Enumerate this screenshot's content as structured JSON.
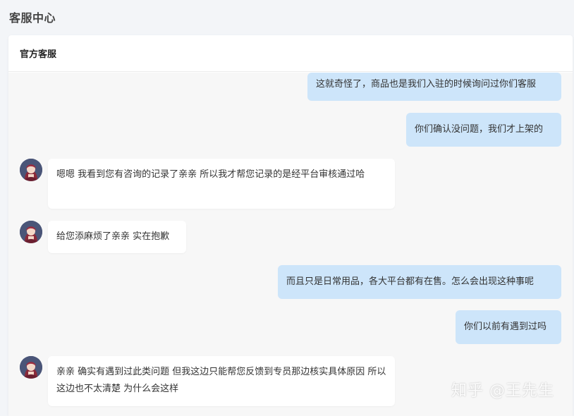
{
  "page": {
    "title": "客服中心"
  },
  "panel": {
    "title": "官方客服"
  },
  "messages": [
    {
      "side": "right",
      "text": "这就奇怪了，商品也是我们入驻的时候询问过你们客服"
    },
    {
      "side": "right",
      "text": "你们确认没问题，我们才上架的"
    },
    {
      "side": "left",
      "avatar": "agent-avatar",
      "text": "嗯嗯 我看到您有咨询的记录了亲亲 所以我才帮您记录的是经平台审核通过哈"
    },
    {
      "side": "left",
      "avatar": "agent-avatar",
      "text": "给您添麻烦了亲亲 实在抱歉"
    },
    {
      "side": "right",
      "text": "而且只是日常用品，各大平台都有在售。怎么会出现这种事呢"
    },
    {
      "side": "right",
      "text": "你们以前有遇到过吗"
    },
    {
      "side": "left",
      "avatar": "agent-avatar",
      "text": "亲亲 确实有遇到过此类问题 但我这边只能帮您反馈到专员那边核实具体原因 所以这边也不太清楚 为什么会这样"
    }
  ],
  "watermark": {
    "text": "知乎 @王先生"
  },
  "colors": {
    "page_bg": "#f3f5f8",
    "chat_bg": "#f7f7f7",
    "right_bubble": "#cde5fa",
    "left_bubble": "#ffffff"
  }
}
